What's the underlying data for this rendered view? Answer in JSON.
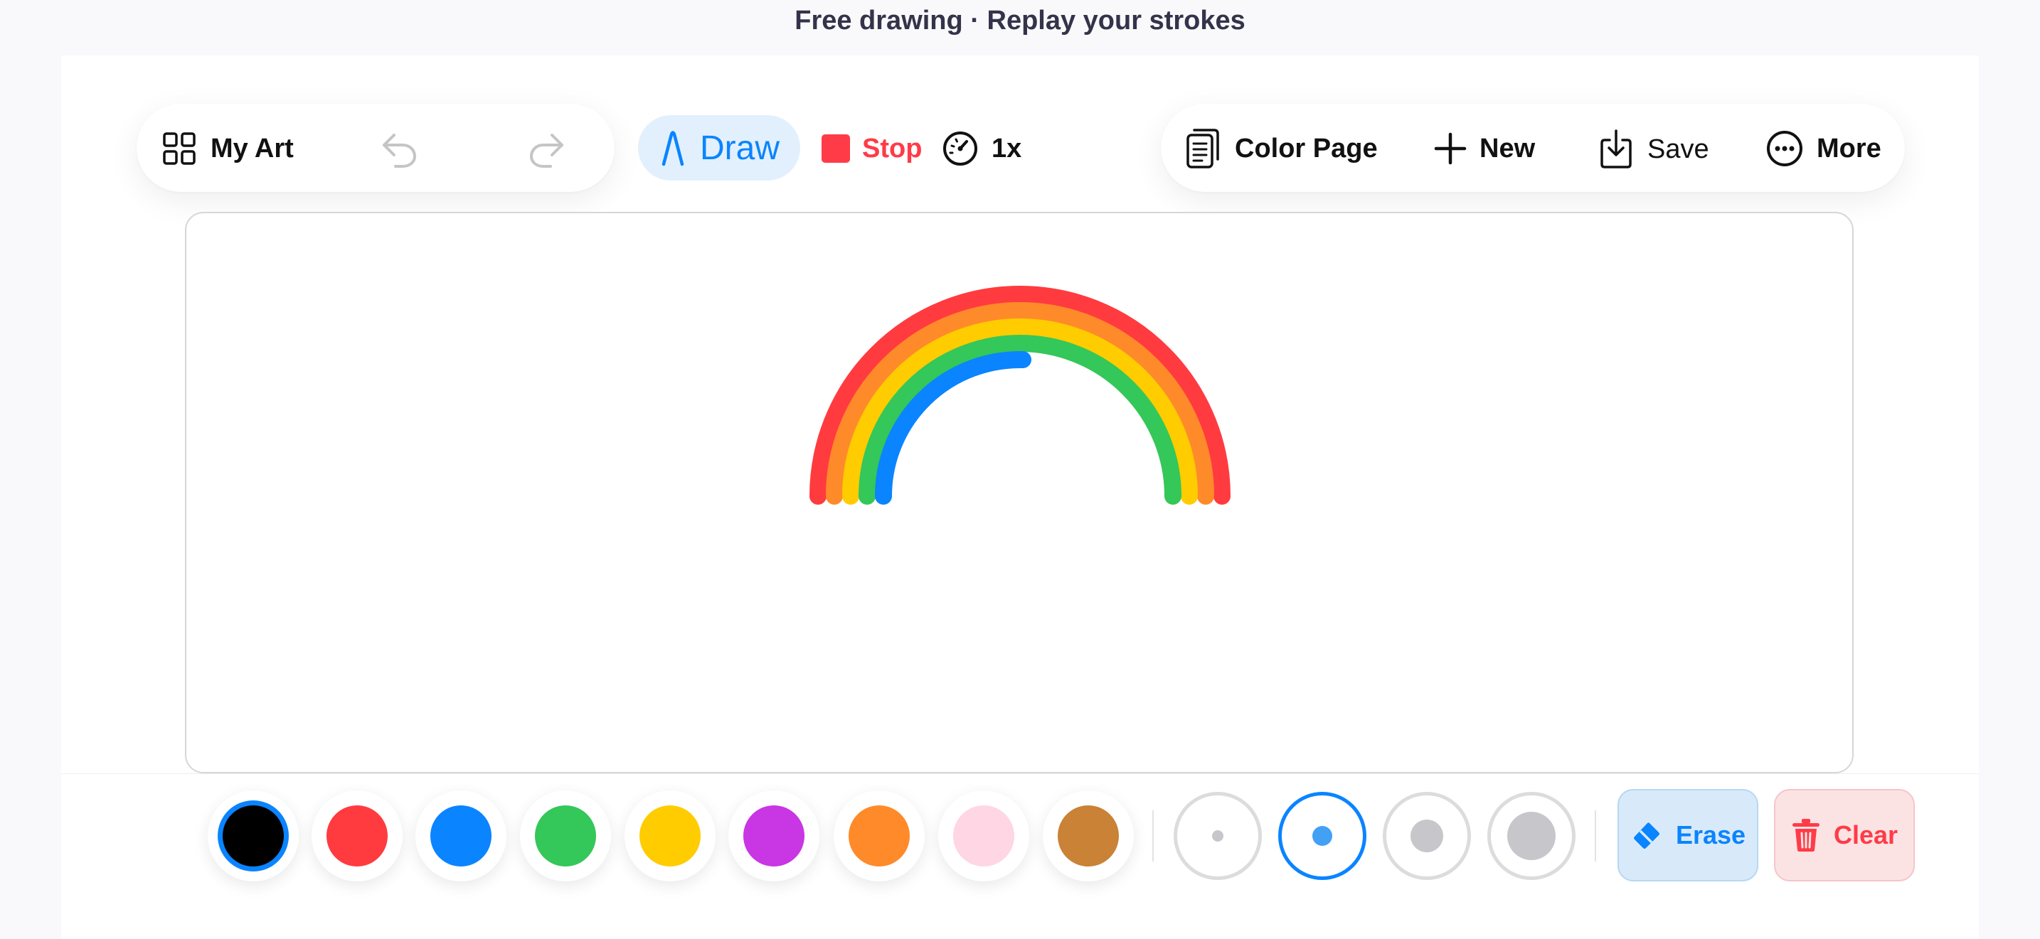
{
  "window": {
    "title": "Free drawing · Replay your strokes"
  },
  "toolbar": {
    "my_art_label": "My Art",
    "draw_label": "Draw",
    "stop_label": "Stop",
    "speed_label": "1x",
    "color_page_label": "Color Page",
    "new_label": "New",
    "save_label": "Save",
    "more_label": "More"
  },
  "icons": {
    "my_art": "grid-icon",
    "undo": "undo-arrow-icon",
    "redo": "redo-arrow-icon",
    "draw": "pen-nib-icon",
    "stop": "stop-square-icon",
    "speed": "gauge-icon",
    "color_page": "pages-icon",
    "new": "plus-icon",
    "save": "save-download-icon",
    "more": "ellipsis-circle-icon",
    "erase": "eraser-icon",
    "clear": "trash-icon"
  },
  "canvas": {
    "drawing": "rainbow",
    "strokes": [
      {
        "color": "#ff3b3f"
      },
      {
        "color": "#ff8a2a"
      },
      {
        "color": "#ffcc00"
      },
      {
        "color": "#34c759"
      },
      {
        "color": "#0a84ff"
      }
    ]
  },
  "palette": {
    "selected_index": 0,
    "colors": [
      "#000000",
      "#ff3b3f",
      "#0a84ff",
      "#34c759",
      "#ffcc00",
      "#c936e3",
      "#ff8a2a",
      "#ffd6e3",
      "#c98236"
    ]
  },
  "brush_sizes": {
    "selected_index": 1,
    "count": 4
  },
  "actions": {
    "erase_label": "Erase",
    "clear_label": "Clear"
  },
  "colors": {
    "accent": "#0a84ff",
    "danger": "#ff3b47",
    "title_text": "#34334a"
  }
}
